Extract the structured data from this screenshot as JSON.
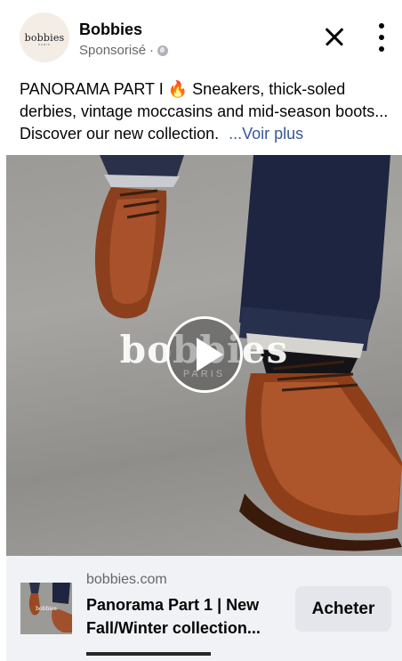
{
  "post": {
    "page_name": "Bobbies",
    "avatar_text": "bobbies",
    "avatar_subtext": "PARIS",
    "sponsored_label": "Sponsorisé",
    "separator": "·",
    "caption_line1": "PANORAMA PART I",
    "caption_emoji": "🔥",
    "caption_rest": "Sneakers, thick-soled derbies, vintage moccasins and mid-season boots... Discover our new collection.",
    "see_more": "...Voir plus",
    "close_icon": "close-icon",
    "more_icon": "more-options-icon"
  },
  "media": {
    "watermark": "bobbies",
    "watermark_sub": "PARIS",
    "play_icon": "play-icon"
  },
  "link": {
    "domain": "bobbies.com",
    "title_line1": "Panorama Part 1 | New",
    "title_line2": "Fall/Winter collection...",
    "thumb_text": "bobbies",
    "cta_label": "Acheter"
  }
}
